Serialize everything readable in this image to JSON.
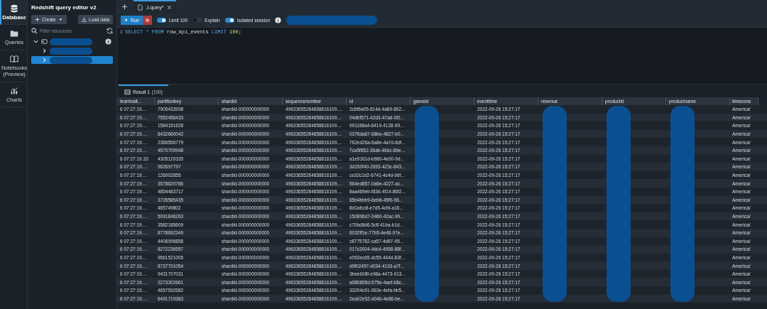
{
  "rail": [
    {
      "label": "Database",
      "selected": true
    },
    {
      "label": "Queries",
      "selected": false
    },
    {
      "label": "Notebooks (Preview)",
      "selected": false
    },
    {
      "label": "Charts",
      "selected": false
    }
  ],
  "panel": {
    "title": "Redshift query editor v2",
    "create": "Create",
    "load": "Load data",
    "filter_placeholder": "Filter resources",
    "tree": [
      {
        "expanded": true,
        "selected": false,
        "redacted": true,
        "children": [
          {
            "expanded": false,
            "selected": false,
            "redacted": true
          },
          {
            "expanded": false,
            "selected": true,
            "redacted": true
          }
        ]
      }
    ]
  },
  "tabs": [
    {
      "label": "J-query*",
      "selected": true
    }
  ],
  "toolbar": {
    "run": "Run",
    "toggles": [
      {
        "label": "Limit 100",
        "on": true
      },
      {
        "label": "Explain",
        "on": false
      },
      {
        "label": "Isolated session",
        "on": true
      }
    ],
    "redacted": true
  },
  "editor": {
    "lines": [
      {
        "number": "1",
        "tokens": [
          {
            "text": "SELECT ",
            "kind": "keyword"
          },
          {
            "text": "* ",
            "kind": "operator"
          },
          {
            "text": "FROM ",
            "kind": "keyword"
          },
          {
            "text": "row_kpi_events ",
            "kind": "identifier"
          },
          {
            "text": "LIMIT ",
            "kind": "keyword"
          },
          {
            "text": "100",
            "kind": "number"
          },
          {
            "text": ";",
            "kind": "identifier"
          }
        ]
      }
    ]
  },
  "results": {
    "tab": "Result 1",
    "count": "(100)",
    "columns": [
      {
        "label": "tearrivalt..."
      },
      {
        "label": "partitionkey"
      },
      {
        "label": "shardid"
      },
      {
        "label": "sequencenumber"
      },
      {
        "label": "id"
      },
      {
        "label": "gameid",
        "redacted": true
      },
      {
        "label": "eventtime"
      },
      {
        "label": "revenue",
        "redacted": true
      },
      {
        "label": "productid",
        "redacted": true
      },
      {
        "label": "productname",
        "redacted": true
      },
      {
        "label": "timezone"
      }
    ],
    "rows": [
      [
        "6 07:27:19....",
        "7905433938",
        "shardId-000000000000",
        "49633655284858816109....",
        "2c6f6a05-814d-4a89-892...",
        "",
        "2022-09-26 15:27:17",
        "",
        "",
        "",
        "America/"
      ],
      [
        "6 07:27:19....",
        "7552456433",
        "shardId-000000000000",
        "49633655284858816109....",
        "04dbf571-42d3-47ad-9f2...",
        "",
        "2022-09-26 15:27:17",
        "",
        "",
        "",
        "America/"
      ],
      [
        "6 07:27:19....",
        "1584151628",
        "shardId-000000000000",
        "49633655284858816109....",
        "991188a4-6419-4128-99...",
        "",
        "2022-09-26 15:27:17",
        "",
        "",
        "",
        "America/"
      ],
      [
        "6 07:27:19....",
        "8432660042",
        "shardId-000000000000",
        "49633655284858816109....",
        "0376da67-68be-4827-b0...",
        "",
        "2022-09-26 15:27:17",
        "",
        "",
        "",
        "America/"
      ],
      [
        "6 07:27:19....",
        "2366556779",
        "shardId-000000000000",
        "49633655284858816109....",
        "762ed26a-6a8e-4a7d-8df...",
        "",
        "2022-09-26 15:27:17",
        "",
        "",
        "",
        "America/"
      ],
      [
        "6 07:27:19....",
        "4570709948",
        "shardId-000000000000",
        "49633655284858816109....",
        "7ca5f852-36ab-46dc-8be...",
        "",
        "2022-09-26 15:27:17",
        "",
        "",
        "",
        "America/"
      ],
      [
        "6 07:27:19.33",
        "4305120335",
        "shardId-000000000000",
        "49633655284858816109....",
        "a1e9161d-b980-4e00-9d...",
        "",
        "2022-09-26 15:27:17",
        "",
        "",
        "",
        "America/"
      ],
      [
        "6 07:27:19....",
        "962697797",
        "shardId-000000000000",
        "49633655284858816109....",
        "3d150f40-2693-423c-843...",
        "",
        "2022-09-26 15:27:17",
        "",
        "",
        "",
        "America/"
      ],
      [
        "6 07:27:19....",
        "126002855",
        "shardId-000000000000",
        "49633655284858816109....",
        "ce32c1d2-6741-4c4d-9df...",
        "",
        "2022-09-26 15:27:17",
        "",
        "",
        "",
        "America/"
      ],
      [
        "6 07:27:19....",
        "3578620786",
        "shardId-000000000000",
        "49633655284858816109....",
        "564ed857-0a6e-4227-ac...",
        "",
        "2022-09-26 15:27:17",
        "",
        "",
        "",
        "America/"
      ],
      [
        "6 07:27:19....",
        "4854483717",
        "shardId-000000000000",
        "49633655284858816109....",
        "8aa469eb-f83d-4f14-86f2...",
        "",
        "2022-09-26 15:27:17",
        "",
        "",
        "",
        "America/"
      ],
      [
        "6 07:27:19....",
        "3735585435",
        "shardId-000000000000",
        "49633655284858816109....",
        "85b4bbb9-6eb8-45f0-96...",
        "",
        "2022-09-26 15:27:17",
        "",
        "",
        "",
        "America/"
      ],
      [
        "6 07:27:19....",
        "465749802",
        "shardId-000000000000",
        "49633655284858816109....",
        "8d1afcc8-e7d5-4cfd-a16...",
        "",
        "2022-09-26 15:27:17",
        "",
        "",
        "",
        "America/"
      ],
      [
        "6 07:27:19....",
        "5091846263",
        "shardId-000000000000",
        "49633655284858816109....",
        "150896d7-0460-42ac-99...",
        "",
        "2022-09-26 15:27:17",
        "",
        "",
        "",
        "America/"
      ],
      [
        "6 07:27:19....",
        "3582185609",
        "shardId-000000000000",
        "49633655284858816109....",
        "c70bd8d6-5cff-41ba-b1d...",
        "",
        "2022-09-26 15:27:17",
        "",
        "",
        "",
        "America/"
      ],
      [
        "6 07:27:19....",
        "8778692349",
        "shardId-000000000000",
        "49633655284858816109....",
        "6032ff1e-77b5-4e48-97e...",
        "",
        "2022-09-26 15:27:17",
        "",
        "",
        "",
        "America/"
      ],
      [
        "6 07:27:19....",
        "4408996858",
        "shardId-000000000000",
        "49633655284858816109....",
        "c8775782-ca57-4d67-95...",
        "",
        "2022-09-26 15:27:17",
        "",
        "",
        "",
        "America/"
      ],
      [
        "6 07:27:19....",
        "8272236557",
        "shardId-000000000000",
        "49633655284858816109....",
        "017c3004-4dc4-4958-88f...",
        "",
        "2022-09-26 15:27:17",
        "",
        "",
        "",
        "America/"
      ],
      [
        "6 07:27:19....",
        "9561521005",
        "shardId-000000000000",
        "49633655284858816109....",
        "e053ec65-dc55-444d-83f...",
        "",
        "2022-09-26 15:27:17",
        "",
        "",
        "",
        "America/"
      ],
      [
        "6 07:27:19....",
        "8737701054",
        "shardId-000000000000",
        "49633655284858816109....",
        "d9f02457-d034-4193-a7f...",
        "",
        "2022-09-26 15:27:17",
        "",
        "",
        "",
        "America/"
      ],
      [
        "6 07:27:19....",
        "9431707031",
        "shardId-000000000000",
        "49633655284858816109....",
        "3beeb08f-e98a-4473-913...",
        "",
        "2022-09-26 15:27:17",
        "",
        "",
        "",
        "America/"
      ],
      [
        "6 07:27:19....",
        "2273302661",
        "shardId-000000000000",
        "49633655284858816109....",
        "a980895d-575e-4aef-b8c...",
        "",
        "2022-09-26 15:27:17",
        "",
        "",
        "",
        "America/"
      ],
      [
        "6 07:27:19....",
        "4657592582",
        "shardId-000000000000",
        "49633655284858816109....",
        "33204c91-063e-4efa-bb5...",
        "",
        "2022-09-26 15:27:17",
        "",
        "",
        "",
        "America/"
      ],
      [
        "6 07:27:19....",
        "6491719383",
        "shardId-000000000000",
        "49633655284858816109....",
        "2ea02e52-d04b-4e86-be...",
        "",
        "2022-09-26 15:27:17",
        "",
        "",
        "",
        "America/"
      ]
    ]
  }
}
